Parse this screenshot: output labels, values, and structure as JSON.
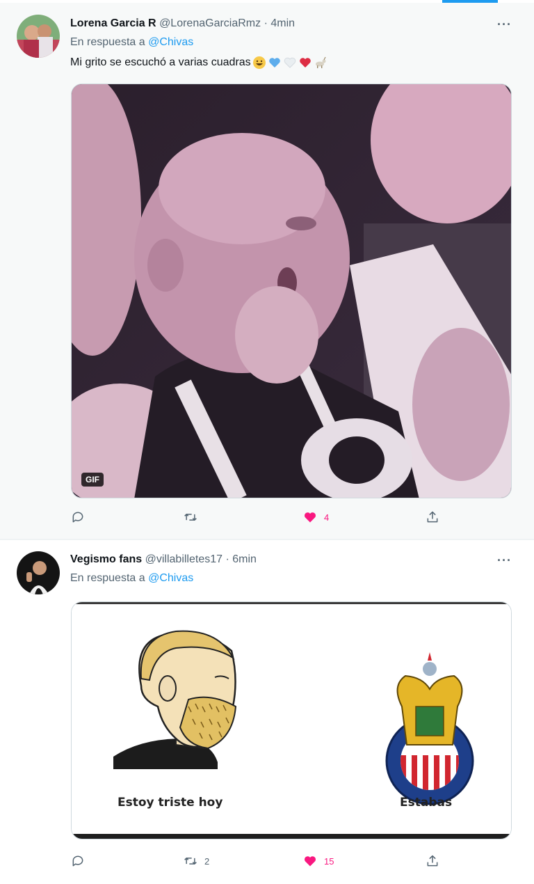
{
  "tweets": [
    {
      "author": {
        "name": "Lorena Garcia R",
        "handle": "@LorenaGarciaRmz"
      },
      "dot": "·",
      "time": "4min",
      "reply_prefix": "En respuesta a",
      "reply_to": "@Chivas",
      "text": "Mi grito se escuchó a varias cuadras",
      "emojis": [
        "grinning-face-emoji",
        "blue-heart-emoji",
        "white-heart-emoji",
        "red-heart-emoji",
        "goat-emoji"
      ],
      "media": {
        "type": "gif",
        "badge": "GIF"
      },
      "stats": {
        "replies": "",
        "retweets": "",
        "likes": "4"
      }
    },
    {
      "author": {
        "name": "Vegismo fans",
        "handle": "@villabilletes17"
      },
      "dot": "·",
      "time": "6min",
      "reply_prefix": "En respuesta a",
      "reply_to": "@Chivas",
      "media": {
        "type": "image",
        "left_caption": "Estoy triste hoy",
        "right_caption": "Estabas"
      },
      "stats": {
        "replies": "",
        "retweets": "2",
        "likes": "15"
      }
    }
  ],
  "colors": {
    "accent": "#1d9bf0",
    "like": "#f91880",
    "muted": "#536471"
  }
}
